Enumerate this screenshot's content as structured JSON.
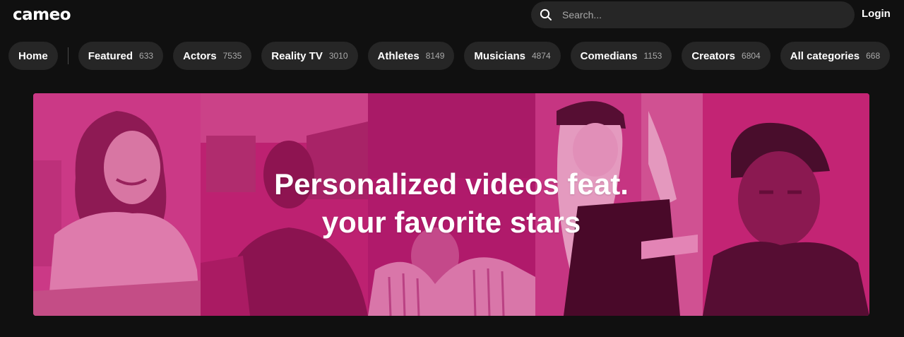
{
  "header": {
    "logo": "cameo",
    "search_placeholder": "Search...",
    "login_label": "Login"
  },
  "categories": {
    "home_label": "Home",
    "items": [
      {
        "label": "Featured",
        "count": "633"
      },
      {
        "label": "Actors",
        "count": "7535"
      },
      {
        "label": "Reality TV",
        "count": "3010"
      },
      {
        "label": "Athletes",
        "count": "8149"
      },
      {
        "label": "Musicians",
        "count": "4874"
      },
      {
        "label": "Comedians",
        "count": "1153"
      },
      {
        "label": "Creators",
        "count": "6804"
      },
      {
        "label": "All categories",
        "count": "668"
      }
    ]
  },
  "hero": {
    "headline_line1": "Personalized videos feat.",
    "headline_line2": "your favorite stars"
  },
  "colors": {
    "background": "#101010",
    "chip": "#262626",
    "hero_magenta": "#c21b72"
  }
}
